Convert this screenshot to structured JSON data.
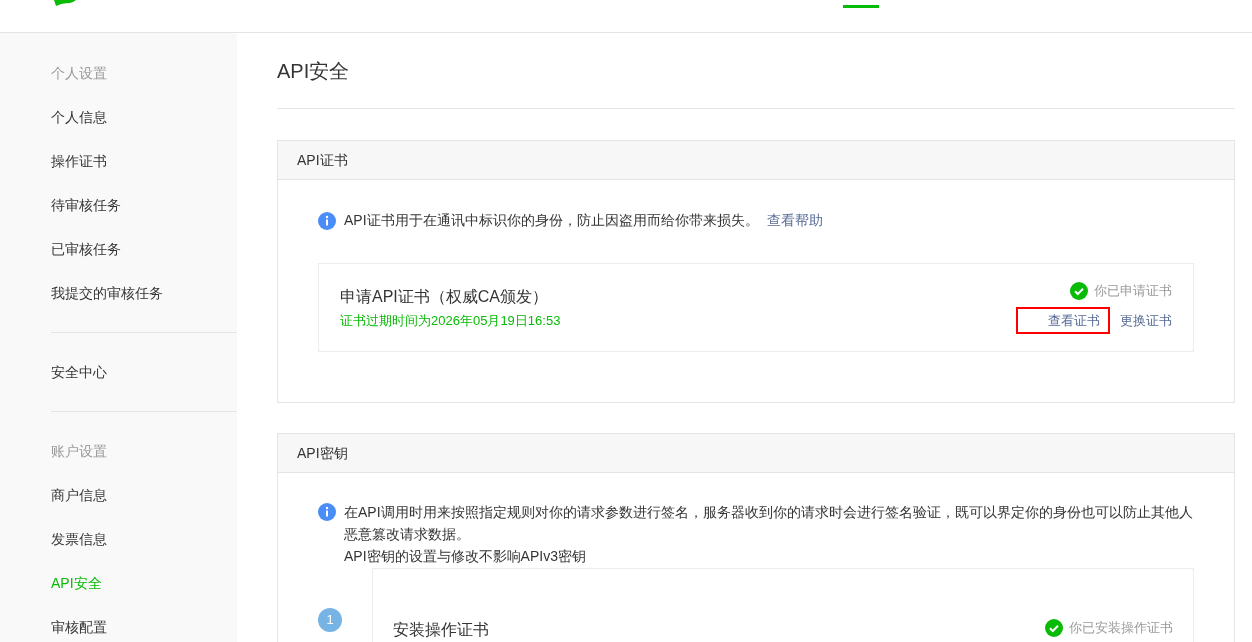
{
  "header": {
    "active_tab_indicator": true
  },
  "sidebar": {
    "groups": [
      {
        "title": "个人设置",
        "items": [
          {
            "label": "个人信息",
            "selected": false
          },
          {
            "label": "操作证书",
            "selected": false
          },
          {
            "label": "待审核任务",
            "selected": false
          },
          {
            "label": "已审核任务",
            "selected": false
          },
          {
            "label": "我提交的审核任务",
            "selected": false
          }
        ]
      },
      {
        "items": [
          {
            "label": "安全中心",
            "selected": false
          }
        ]
      },
      {
        "title": "账户设置",
        "items": [
          {
            "label": "商户信息",
            "selected": false
          },
          {
            "label": "发票信息",
            "selected": false
          },
          {
            "label": "API安全",
            "selected": true
          },
          {
            "label": "审核配置",
            "selected": false
          }
        ]
      }
    ]
  },
  "page_title": "API安全",
  "api_certificate": {
    "title": "API证书",
    "info": "API证书用于在通讯中标识你的身份，防止因盗用而给你带来损失。",
    "help_link": "查看帮助",
    "item": {
      "title": "申请API证书（权威CA颁发）",
      "expiry": "证书过期时间为2026年05月19日16:53",
      "status": "你已申请证书",
      "done": true,
      "actions": [
        {
          "label": "查看证书",
          "highlighted": true
        },
        {
          "label": "更换证书",
          "highlighted": false
        }
      ]
    }
  },
  "api_key": {
    "title": "API密钥",
    "info": [
      "在API调用时用来按照指定规则对你的请求参数进行签名，服务器收到你的请求时会进行签名验证，既可以界定你的身份也可以防止其他人恶意篡改请求数据。",
      "API密钥的设置与修改不影响APIv3密钥"
    ],
    "steps": [
      {
        "number": "1",
        "title": "安装操作证书",
        "status": "你已安装操作证书",
        "done": true
      }
    ]
  }
}
